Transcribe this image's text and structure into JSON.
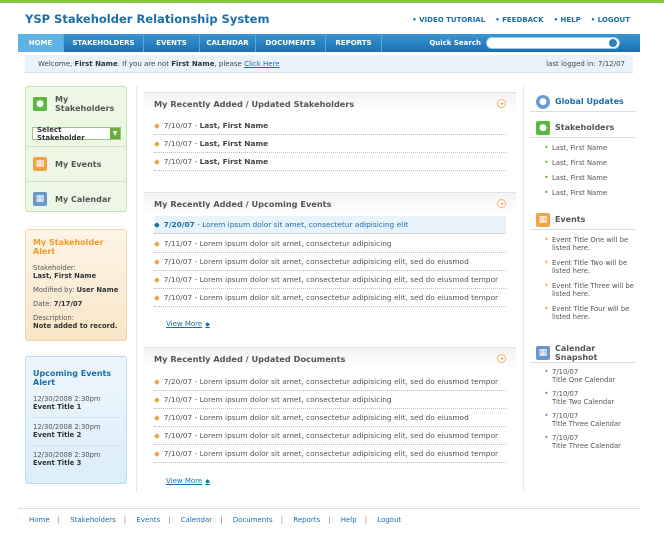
{
  "app": {
    "title": "YSP Stakeholder Relationship System"
  },
  "toplinks": [
    "VIDEO TUTORIAL",
    "FEEDBACK",
    "HELP",
    "LOGOUT"
  ],
  "nav": {
    "items": [
      "HOME",
      "STAKEHOLDERS",
      "EVENTS",
      "CALENDAR",
      "DOCUMENTS",
      "REPORTS"
    ],
    "search_label": "Quick Search",
    "search_value": ""
  },
  "welcome": {
    "prefix": "Welcome, ",
    "name": "First Name",
    "middle": ". If you are not ",
    "name2": "First Name",
    "suffix": ", please ",
    "link": "Click Here",
    "last_logged": "last logged in: 7/12/07"
  },
  "left": {
    "my_stakeholders": "My Stakeholders",
    "select_label": "Select Stakeholder",
    "my_events": "My Events",
    "my_calendar": "My Calendar",
    "alert": {
      "title": "My Stakeholder Alert",
      "stakeholder_label": "Stakeholder:",
      "stakeholder_value": "Last, First Name",
      "modified_label": "Modified by:",
      "modified_value": "User Name",
      "date_label": "Date:",
      "date_value": "7/17/07",
      "desc_label": "Description:",
      "desc_value": "Note added to record."
    },
    "upcoming": {
      "title": "Upcoming Events Alert",
      "events": [
        {
          "datetime": "12/30/2008 2:30pm",
          "title": "Event Title 1"
        },
        {
          "datetime": "12/30/2008 2:30pm",
          "title": "Event Title 2"
        },
        {
          "datetime": "12/30/2008 2:30pm",
          "title": "Event Title 3"
        }
      ]
    }
  },
  "center": {
    "stakeholders": {
      "title": "My Recently Added / Updated Stakeholders",
      "rows": [
        {
          "date": "7/10/07",
          "text": "Last, First Name"
        },
        {
          "date": "7/10/07",
          "text": "Last, First Name"
        },
        {
          "date": "7/10/07",
          "text": "Last, First Name"
        }
      ]
    },
    "events": {
      "title": "My Recently Added / Upcoming Events",
      "rows": [
        {
          "date": "7/20/07",
          "text": "Lorem ipsum dolor sit amet, consectetur adipisicing elit"
        },
        {
          "date": "7/11/07",
          "text": "Lorem ipsum dolor sit amet, consectetur adipisicing"
        },
        {
          "date": "7/10/07",
          "text": "Lorem ipsum dolor sit amet, consectetur adipisicing elit, sed do eiusmod"
        },
        {
          "date": "7/10/07",
          "text": "Lorem ipsum dolor sit amet, consectetur adipisicing elit, sed do eiusmod tempor"
        },
        {
          "date": "7/10/07",
          "text": "Lorem ipsum dolor sit amet, consectetur adipisicing elit, sed do eiusmod tempor"
        }
      ],
      "view_more": "View More"
    },
    "documents": {
      "title": "My Recently Added / Updated Documents",
      "rows": [
        {
          "date": "7/20/07",
          "text": "Lorem ipsum dolor sit amet, consectetur adipisicing elit, sed do eiusmod tempor"
        },
        {
          "date": "7/10/07",
          "text": "Lorem ipsum dolor sit amet, consectetur adipisicing"
        },
        {
          "date": "7/10/07",
          "text": "Lorem ipsum dolor sit amet, consectetur adipisicing elit, sed do eiusmod"
        },
        {
          "date": "7/10/07",
          "text": "Lorem ipsum dolor sit amet, consectetur adipisicing elit, sed do eiusmod tempor"
        },
        {
          "date": "7/10/07",
          "text": "Lorem ipsum dolor sit amet, consectetur adipisicing elit, sed do eiusmod tempor"
        }
      ],
      "view_more": "View More"
    }
  },
  "right": {
    "global_updates": "Global Updates",
    "stakeholders": {
      "title": "Stakeholders",
      "items": [
        "Last, First Name",
        "Last, First Name",
        "Last, First Name",
        "Last, First Name"
      ]
    },
    "events": {
      "title": "Events",
      "items": [
        "Event Title One will be listed here.",
        "Event Title Two will be listed here.",
        "Event Title Three will be listed here.",
        "Event Title Four will be listed here."
      ]
    },
    "calendar": {
      "title": "Calendar Snapshot",
      "items": [
        {
          "date": "7/10/07",
          "title": "Title One Calendar"
        },
        {
          "date": "7/10/07",
          "title": "Title Two Calendar"
        },
        {
          "date": "7/10/07",
          "title": "Title Three Calendar"
        },
        {
          "date": "7/10/07",
          "title": "Title Three Calendar"
        }
      ]
    }
  },
  "footer": [
    "Home",
    "Stakeholders",
    "Events",
    "Calendar",
    "Documents",
    "Reports",
    "Help",
    "Logout"
  ]
}
